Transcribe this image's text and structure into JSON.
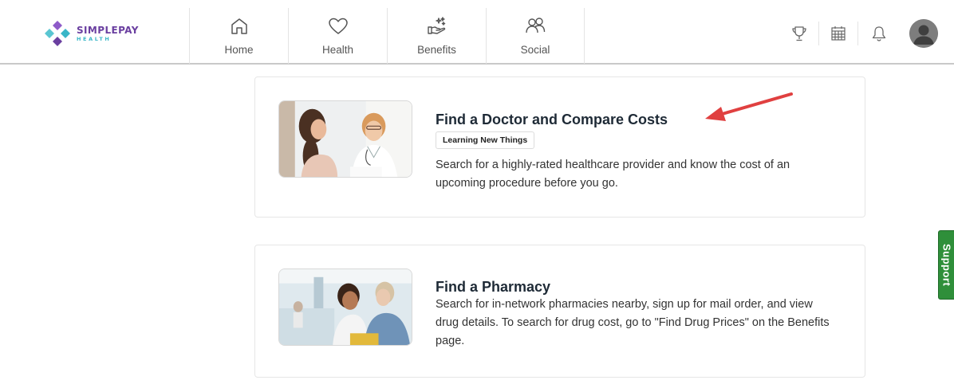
{
  "brand": {
    "name": "SIMPLEPAY",
    "subtitle": "HEALTH",
    "colors": {
      "purple": "#6a3fa0",
      "teal": "#39b6c7"
    }
  },
  "nav": {
    "items": [
      {
        "label": "Home",
        "icon": "home-icon"
      },
      {
        "label": "Health",
        "icon": "heart-icon"
      },
      {
        "label": "Benefits",
        "icon": "hand-sparkle-icon"
      },
      {
        "label": "Social",
        "icon": "people-icon"
      }
    ]
  },
  "header_actions": {
    "icons": [
      "trophy-icon",
      "calendar-icon",
      "bell-icon",
      "avatar-icon"
    ]
  },
  "cards": [
    {
      "title": "Find a Doctor and Compare Costs",
      "tag": "Learning New Things",
      "description": "Search for a highly-rated healthcare provider and know the cost of an upcoming procedure before you go."
    },
    {
      "title": "Find a Pharmacy",
      "description": "Search for in-network pharmacies nearby, sign up for mail order, and view drug details. To search for drug cost, go to \"Find Drug Prices\" on the Benefits page."
    }
  ],
  "support": {
    "label": "Support",
    "color": "#2f8f3a"
  },
  "annotation": {
    "arrow_color": "#e04040"
  }
}
